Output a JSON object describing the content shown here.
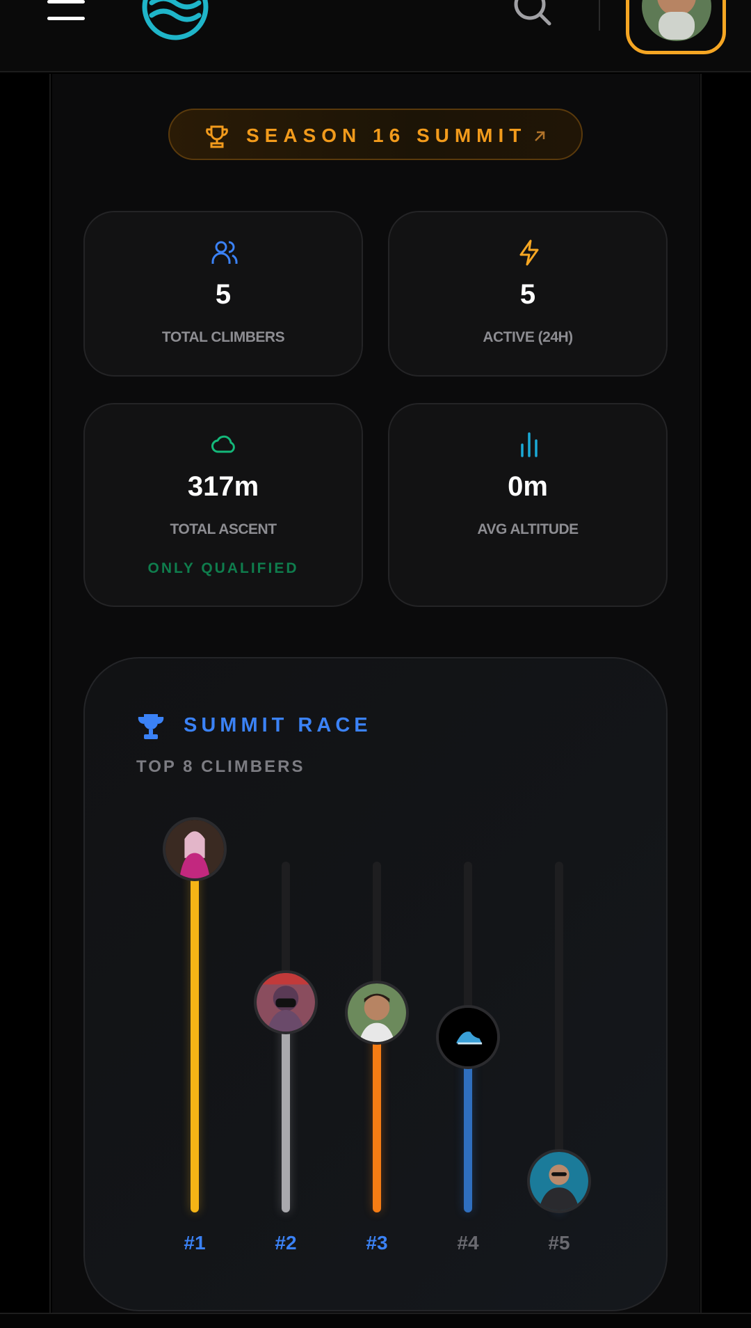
{
  "header": {
    "menu_icon": "hamburger-icon",
    "logo_icon": "wave-logo-icon",
    "search_icon": "search-icon",
    "profile_avatar": "user-avatar"
  },
  "season": {
    "label": "SEASON 16 SUMMIT",
    "icon": "trophy-icon",
    "link_icon": "arrow-up-right-icon",
    "accent": "#f29b1c"
  },
  "stats": [
    {
      "icon": "users-icon",
      "icon_color": "#3b82f6",
      "value": "5",
      "label": "TOTAL CLIMBERS"
    },
    {
      "icon": "lightning-icon",
      "icon_color": "#f5a623",
      "value": "5",
      "label": "ACTIVE (24H)"
    },
    {
      "icon": "cloud-icon",
      "icon_color": "#14b87a",
      "value": "317m",
      "label": "TOTAL ASCENT",
      "note": "ONLY QUALIFIED"
    },
    {
      "icon": "bar-chart-icon",
      "icon_color": "#1ba9d6",
      "value": "0m",
      "label": "AVG ALTITUDE"
    }
  ],
  "race": {
    "title": "SUMMIT RACE",
    "subtitle": "TOP 8 CLIMBERS",
    "climbers": [
      {
        "rank": "#1",
        "progress": 1.0,
        "color": "#f5b416",
        "rank_color": "#3b82f6"
      },
      {
        "rank": "#2",
        "progress": 0.6,
        "color": "#a9a9ad",
        "rank_color": "#3b82f6"
      },
      {
        "rank": "#3",
        "progress": 0.57,
        "color": "#f57c14",
        "rank_color": "#3b82f6"
      },
      {
        "rank": "#4",
        "progress": 0.5,
        "color": "#2f6fbf",
        "rank_color": "#6a6a70"
      },
      {
        "rank": "#5",
        "progress": 0.09,
        "color": "#3a7fd0",
        "rank_color": "#6a6a70"
      }
    ]
  }
}
